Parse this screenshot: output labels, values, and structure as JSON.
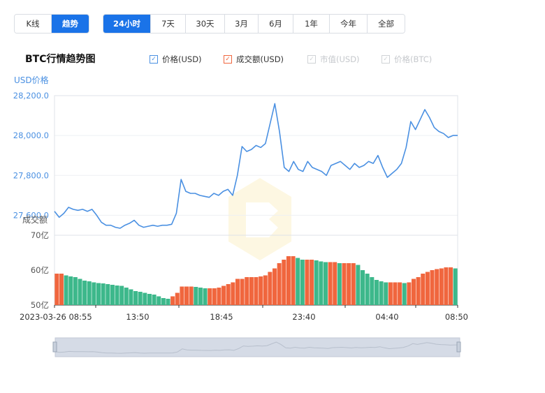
{
  "view_tabs": [
    {
      "label": "K线",
      "active": false
    },
    {
      "label": "趋势",
      "active": true
    }
  ],
  "range_tabs": [
    {
      "label": "24小时",
      "active": true
    },
    {
      "label": "7天",
      "active": false
    },
    {
      "label": "30天",
      "active": false
    },
    {
      "label": "3月",
      "active": false
    },
    {
      "label": "6月",
      "active": false
    },
    {
      "label": "1年",
      "active": false
    },
    {
      "label": "今年",
      "active": false
    },
    {
      "label": "全部",
      "active": false
    }
  ],
  "chart_title": "BTC行情趋势图",
  "legend": [
    {
      "label": "价格(USD)",
      "checked": true,
      "color": "#4a90e2",
      "mark": "✓"
    },
    {
      "label": "成交额(USD)",
      "checked": true,
      "color": "#f0663e",
      "mark": "✓"
    },
    {
      "label": "市值(USD)",
      "checked": false,
      "color": "#d0d3d6",
      "mark": "✓"
    },
    {
      "label": "价格(BTC)",
      "checked": false,
      "color": "#d0d3d6",
      "mark": "✓"
    }
  ],
  "colors": {
    "price_line": "#4a90e2",
    "vol_up": "#3db88b",
    "vol_down": "#f0663e",
    "accent": "#1a73e8",
    "axis_text": "#4a90e2"
  },
  "chart_data": [
    {
      "type": "line",
      "ylabel": "USD价格",
      "ylim": [
        27500,
        28200
      ],
      "y_ticks": [
        "28,200.0",
        "28,000.0",
        "27,800.0",
        "27,600.0"
      ],
      "x_tick_labels": [
        "2023-03-26 08:55",
        "13:50",
        "18:45",
        "23:40",
        "04:40",
        "08:50"
      ],
      "series": [
        {
          "values": [
            27620,
            27590,
            27610,
            27640,
            27630,
            27625,
            27630,
            27620,
            27630,
            27600,
            27565,
            27550,
            27550,
            27540,
            27535,
            27550,
            27560,
            27575,
            27550,
            27540,
            27545,
            27550,
            27545,
            27550,
            27550,
            27555,
            27610,
            27780,
            27720,
            27710,
            27710,
            27700,
            27695,
            27690,
            27710,
            27700,
            27720,
            27730,
            27700,
            27800,
            27945,
            27920,
            27930,
            27950,
            27940,
            27960,
            28060,
            28160,
            28020,
            27840,
            27820,
            27870,
            27830,
            27820,
            27870,
            27840,
            27830,
            27820,
            27800,
            27850,
            27860,
            27870,
            27850,
            27830,
            27860,
            27840,
            27850,
            27870,
            27860,
            27900,
            27840,
            27790,
            27810,
            27830,
            27860,
            27940,
            28070,
            28030,
            28080,
            28130,
            28090,
            28040,
            28020,
            28010,
            27990,
            28000,
            28000
          ]
        }
      ]
    },
    {
      "type": "bar",
      "ylabel": "成交额",
      "ylim": [
        50,
        70
      ],
      "y_ticks": [
        "70亿",
        "60亿",
        "50亿"
      ],
      "series": [
        {
          "values": [
            59,
            59,
            58.5,
            58.2,
            58,
            57.5,
            57,
            56.8,
            56.5,
            56.3,
            56.2,
            56,
            55.8,
            55.6,
            55.5,
            55,
            54.5,
            54,
            53.8,
            53.5,
            53.2,
            53,
            52.5,
            52,
            51.8,
            52.5,
            53.5,
            55.3,
            55.3,
            55.3,
            55.2,
            55,
            54.8,
            54.8,
            54.8,
            55,
            55.5,
            56,
            56.5,
            57.5,
            57.5,
            58,
            58,
            58,
            58.2,
            58.5,
            59.5,
            60.5,
            62,
            63,
            64,
            64,
            63.5,
            63,
            63,
            63,
            62.8,
            62.5,
            62.3,
            62.3,
            62.3,
            62,
            62,
            62,
            62,
            61.5,
            60,
            59,
            58,
            57.2,
            56.8,
            56.5,
            56.5,
            56.5,
            56.5,
            56.3,
            56.5,
            57.5,
            58,
            59,
            59.5,
            60,
            60.3,
            60.5,
            60.8,
            60.8,
            60.5
          ]
        }
      ]
    }
  ]
}
